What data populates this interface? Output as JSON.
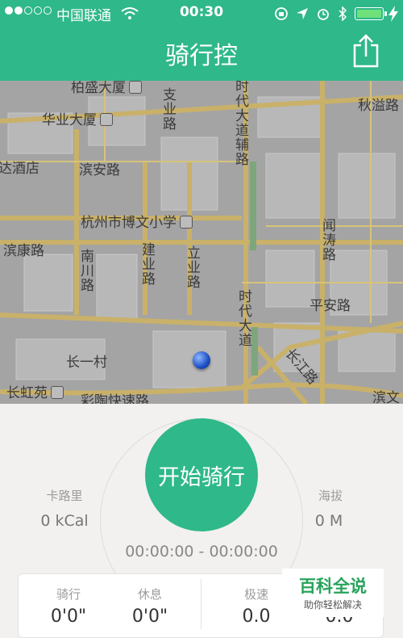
{
  "status_bar": {
    "carrier": "中国联通",
    "time": "00:30",
    "battery_color": "#6fe07a"
  },
  "nav": {
    "title": "骑行控",
    "share_icon": "share-icon"
  },
  "map": {
    "labels": {
      "baisheng": "柏盛大厦",
      "huaye": "华业大厦",
      "zhiye": "支业路",
      "shidai_top": "时代大道辅路",
      "qiuyi": "秋溢路",
      "dajiudian": "达酒店",
      "binan": "滨安路",
      "hangzhou_school": "杭州市博文小学",
      "binkang": "滨康路",
      "nanchuan": "南川路",
      "jianye": "建业路",
      "liye": "立业路",
      "wangtou": "闻涛路",
      "pingan": "平安路",
      "shidai_bottom": "时代大道",
      "changyi": "长一村",
      "changjiang": "长江路",
      "changhong": "长虹苑",
      "caitao": "彩陶快速路",
      "binjiang": "滨文"
    }
  },
  "ride": {
    "start_label": "开始骑行",
    "calories_label": "卡路里",
    "calories_value": "0 kCal",
    "altitude_label": "海拔",
    "altitude_value": "0 M",
    "timer": "00:00:00 - 00:00:00"
  },
  "stats_panel": {
    "riding_label": "骑行",
    "riding_value": "0'0\"",
    "rest_label": "休息",
    "rest_value": "0'0\"",
    "max_speed_label": "极速",
    "max_speed_value": "0.0",
    "avg_speed_value": "0.0"
  },
  "watermark": {
    "title": "百科全说",
    "subtitle": "助你轻松解决"
  },
  "colors": {
    "accent": "#2fb88a"
  }
}
